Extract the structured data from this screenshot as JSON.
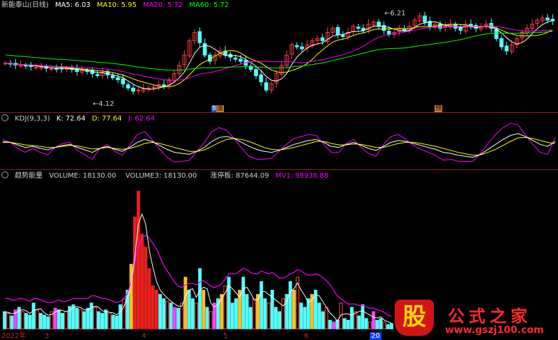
{
  "main_legend": {
    "name": "新能泰山(日线)",
    "ma5": "MA5: 6.03",
    "ma10": "MA10: 5.95",
    "ma20": "MA20: 5.72",
    "ma60": "MA60: 5.72"
  },
  "kdj_legend": {
    "name": "KDJ(9,3,3)",
    "k": "K: 72.64",
    "d": "D: 77.64",
    "j": "J: 62.64"
  },
  "vol_legend": {
    "name": "趋势能量",
    "volume": "VOLUME: 18130.00",
    "volume3": "VOLUME3: 18130.00",
    "zt": "涨停板: 87644.09",
    "mv1": "MV1: 98938.88"
  },
  "annotations": {
    "high": "6.21",
    "low": "4.12",
    "tag_zhang": "涨",
    "tag_yu": "预",
    "tag_num": "8"
  },
  "x_axis": {
    "labels": [
      "2022年",
      "3",
      "4",
      "5",
      "6",
      "20"
    ]
  },
  "logo": {
    "badge": "股",
    "brand": "公式之家",
    "url": "www.gszj100.com"
  },
  "colors": {
    "up": "#ff3b3b",
    "down": "#54ffff",
    "ma5": "#ffffff",
    "ma10": "#ffff00",
    "ma20": "#ff00ff",
    "ma60": "#00ff00",
    "kdj_k": "#ffffff",
    "kdj_d": "#ffff00",
    "kdj_j": "#ff00ff",
    "vol_red": "#e8201a",
    "vol_yellow": "#ffc020",
    "vol_cyan": "#54ffff",
    "vol_magenta": "#ff40ff",
    "vol_outline": "#ff4a4a"
  },
  "chart_data": {
    "type": "candlestick",
    "ylim": [
      4.0,
      6.3
    ],
    "closes": [
      5.0,
      4.98,
      4.96,
      4.95,
      4.94,
      4.92,
      4.9,
      4.9,
      4.88,
      4.87,
      4.86,
      4.87,
      4.88,
      4.85,
      4.8,
      4.82,
      4.8,
      4.75,
      4.7,
      4.78,
      4.72,
      4.65,
      4.6,
      4.5,
      4.4,
      4.32,
      4.35,
      4.38,
      4.4,
      4.42,
      4.48,
      4.45,
      4.6,
      4.75,
      4.95,
      5.2,
      5.55,
      5.75,
      5.5,
      5.2,
      5.05,
      5.2,
      5.3,
      5.2,
      5.15,
      5.1,
      5.05,
      4.95,
      4.85,
      4.7,
      4.55,
      4.35,
      4.5,
      4.75,
      4.95,
      5.2,
      5.45,
      5.4,
      5.35,
      5.45,
      5.55,
      5.6,
      5.55,
      5.75,
      5.85,
      5.7,
      5.65,
      5.75,
      5.9,
      5.85,
      5.8,
      5.95,
      6.0,
      5.9,
      5.8,
      5.7,
      5.75,
      5.85,
      5.8,
      5.9,
      6.05,
      6.15,
      6.0,
      5.9,
      5.95,
      5.85,
      5.9,
      5.95,
      5.85,
      5.8,
      5.95,
      5.9,
      5.85,
      5.9,
      5.95,
      5.85,
      5.6,
      5.4,
      5.3,
      5.45,
      5.6,
      5.75,
      5.85,
      5.95,
      6.05,
      6.1,
      6.05,
      6.03
    ],
    "kdj": {
      "k": [
        72,
        70,
        65,
        60,
        62,
        58,
        55,
        60,
        64,
        66,
        60,
        55,
        50,
        58,
        62,
        56,
        52,
        60,
        70,
        76,
        72,
        64,
        56,
        50,
        48,
        46,
        52,
        60,
        72,
        80,
        82,
        78,
        70,
        62,
        56,
        52,
        50,
        54,
        60,
        66,
        70,
        74,
        76,
        70,
        62,
        60,
        66,
        70,
        64,
        58,
        54,
        62,
        70,
        74,
        72,
        68,
        64,
        60,
        56,
        50,
        48,
        44,
        42,
        40,
        46,
        56,
        66,
        76,
        84,
        88,
        82,
        74,
        66,
        62,
        72
      ],
      "d": [
        70,
        70,
        68,
        65,
        64,
        62,
        60,
        60,
        62,
        64,
        63,
        60,
        57,
        58,
        60,
        58,
        56,
        58,
        62,
        68,
        70,
        68,
        64,
        60,
        56,
        52,
        52,
        55,
        62,
        70,
        76,
        78,
        76,
        72,
        66,
        60,
        56,
        55,
        57,
        60,
        64,
        68,
        72,
        72,
        68,
        65,
        65,
        67,
        66,
        63,
        60,
        60,
        64,
        68,
        70,
        70,
        68,
        65,
        62,
        58,
        54,
        50,
        47,
        44,
        45,
        50,
        56,
        64,
        72,
        79,
        80,
        78,
        74,
        70,
        68
      ],
      "j": [
        76,
        70,
        58,
        50,
        58,
        50,
        45,
        60,
        68,
        70,
        54,
        45,
        36,
        58,
        66,
        52,
        44,
        64,
        86,
        92,
        76,
        56,
        40,
        30,
        32,
        34,
        52,
        70,
        92,
        100,
        94,
        78,
        58,
        42,
        36,
        36,
        38,
        52,
        66,
        78,
        82,
        86,
        84,
        66,
        50,
        50,
        68,
        76,
        60,
        48,
        42,
        66,
        82,
        86,
        76,
        64,
        56,
        50,
        44,
        34,
        36,
        32,
        32,
        32,
        48,
        68,
        86,
        100,
        108,
        106,
        86,
        66,
        50,
        46,
        80
      ]
    },
    "volume": {
      "bars": [
        20,
        18,
        15,
        22,
        25,
        20,
        18,
        16,
        30,
        22,
        18,
        16,
        14,
        20,
        24,
        22,
        18,
        20,
        26,
        28,
        24,
        22,
        20,
        24,
        30,
        25,
        20,
        18,
        22,
        18,
        16,
        15,
        28,
        35,
        45,
        75,
        130,
        160,
        110,
        95,
        70,
        50,
        45,
        40,
        35,
        32,
        30,
        25,
        24,
        30,
        60,
        45,
        35,
        30,
        70,
        45,
        25,
        20,
        30,
        35,
        40,
        50,
        60,
        30,
        35,
        45,
        60,
        40,
        25,
        35,
        40,
        55,
        35,
        30,
        45,
        25,
        20,
        35,
        40,
        55,
        45,
        60,
        30,
        25,
        35,
        40,
        45,
        30,
        20,
        25,
        10,
        8,
        10,
        30,
        12,
        10,
        25,
        20,
        15,
        28,
        12,
        8,
        20,
        10,
        12,
        8,
        5,
        6
      ],
      "mv1": [
        22,
        22,
        21,
        21,
        22,
        22,
        21,
        20,
        22,
        22,
        21,
        20,
        19,
        19,
        20,
        21,
        20,
        20,
        21,
        22,
        22,
        22,
        22,
        22,
        24,
        24,
        23,
        22,
        22,
        21,
        20,
        19,
        20,
        22,
        26,
        34,
        48,
        60,
        66,
        68,
        66,
        62,
        58,
        52,
        46,
        42,
        38,
        34,
        31,
        30,
        32,
        33,
        33,
        32,
        34,
        35,
        33,
        31,
        30,
        31,
        33,
        36,
        40,
        40,
        40,
        42,
        44,
        43,
        41,
        40,
        40,
        42,
        41,
        40,
        41,
        39,
        37,
        37,
        38,
        40,
        41,
        43,
        42,
        40,
        39,
        39,
        40,
        39,
        37,
        35,
        32,
        28,
        24,
        22,
        20,
        18,
        18,
        18,
        17,
        17,
        16,
        15,
        15,
        14,
        13,
        12,
        10,
        9
      ]
    }
  }
}
